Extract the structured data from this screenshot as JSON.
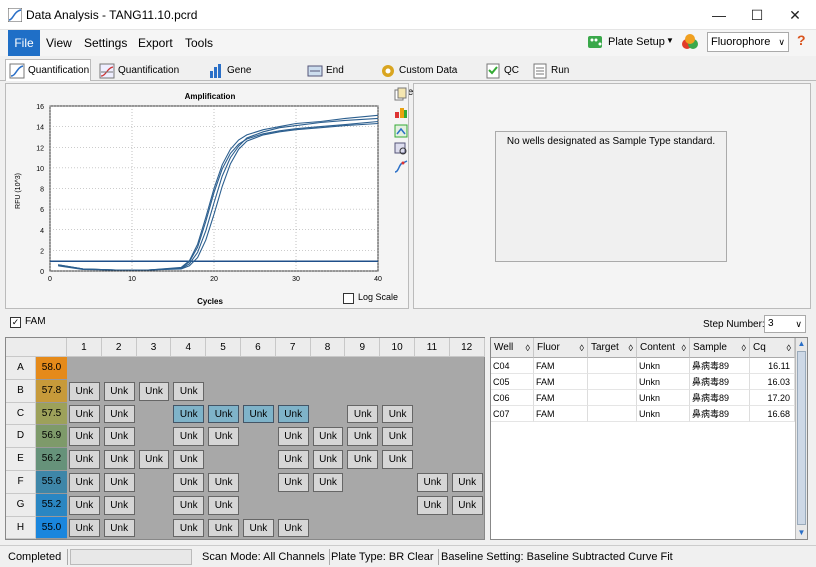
{
  "window": {
    "title": "Data Analysis - TANG11.10.pcrd",
    "minimize": "—",
    "maximize": "☐",
    "close": "✕"
  },
  "menu": [
    "File",
    "View",
    "Settings",
    "Export",
    "Tools"
  ],
  "toolbar": {
    "plate_setup": "Plate Setup",
    "fluorophore": "Fluorophore",
    "help": "?"
  },
  "tabs": [
    "Quantification",
    "Quantification Data",
    "Gene Expression",
    "End Point",
    "Custom Data View",
    "QC",
    "Run Information"
  ],
  "chart_panel": {
    "log_scale_label": "Log Scale"
  },
  "right_panel": {
    "message": "No wells designated as Sample Type standard."
  },
  "fam": {
    "label": "FAM",
    "step_label": "Step Number:",
    "step_value": "3"
  },
  "plate": {
    "cols": [
      "1",
      "2",
      "3",
      "4",
      "5",
      "6",
      "7",
      "8",
      "9",
      "10",
      "11",
      "12"
    ],
    "rows": [
      {
        "label": "A",
        "temp": "58.0",
        "color": "#e58a1a",
        "wells": [
          "",
          "",
          "",
          "",
          "",
          "",
          "",
          "",
          "",
          "",
          "",
          ""
        ]
      },
      {
        "label": "B",
        "temp": "57.8",
        "color": "#c79a3a",
        "wells": [
          "Unk",
          "Unk",
          "Unk",
          "Unk",
          "",
          "",
          "",
          "",
          "",
          "",
          "",
          ""
        ]
      },
      {
        "label": "C",
        "temp": "57.5",
        "color": "#9da15a",
        "wells": [
          "Unk",
          "Unk",
          "",
          "Unk",
          "Unk",
          "Unk",
          "Unk",
          "",
          "Unk",
          "Unk",
          "",
          ""
        ]
      },
      {
        "label": "D",
        "temp": "56.9",
        "color": "#7e9a6a",
        "wells": [
          "Unk",
          "Unk",
          "",
          "Unk",
          "Unk",
          "",
          "Unk",
          "Unk",
          "Unk",
          "Unk",
          "",
          ""
        ]
      },
      {
        "label": "E",
        "temp": "56.2",
        "color": "#66927a",
        "wells": [
          "Unk",
          "Unk",
          "Unk",
          "Unk",
          "",
          "",
          "Unk",
          "Unk",
          "Unk",
          "Unk",
          "",
          ""
        ]
      },
      {
        "label": "F",
        "temp": "55.6",
        "color": "#3e86a8",
        "wells": [
          "Unk",
          "Unk",
          "",
          "Unk",
          "Unk",
          "",
          "Unk",
          "Unk",
          "",
          "",
          "Unk",
          "Unk"
        ]
      },
      {
        "label": "G",
        "temp": "55.2",
        "color": "#2a86c2",
        "wells": [
          "Unk",
          "Unk",
          "",
          "Unk",
          "Unk",
          "",
          "",
          "",
          "",
          "",
          "Unk",
          "Unk"
        ]
      },
      {
        "label": "H",
        "temp": "55.0",
        "color": "#1a86dd",
        "wells": [
          "Unk",
          "Unk",
          "",
          "Unk",
          "Unk",
          "Unk",
          "Unk",
          "",
          "",
          "",
          "",
          ""
        ]
      }
    ]
  },
  "table": {
    "headers": [
      "Well",
      "Fluor",
      "Target",
      "Content",
      "Sample",
      "Cq"
    ],
    "rows": [
      [
        "C04",
        "FAM",
        "",
        "Unkn",
        "鼻病毒89",
        "16.11"
      ],
      [
        "C05",
        "FAM",
        "",
        "Unkn",
        "鼻病毒89",
        "16.03"
      ],
      [
        "C06",
        "FAM",
        "",
        "Unkn",
        "鼻病毒89",
        "17.20"
      ],
      [
        "C07",
        "FAM",
        "",
        "Unkn",
        "鼻病毒89",
        "16.68"
      ]
    ]
  },
  "status": {
    "state": "Completed",
    "scan_mode": "Scan Mode: All Channels",
    "plate_type": "Plate Type: BR Clear",
    "baseline": "Baseline Setting: Baseline Subtracted Curve Fit"
  },
  "chart_data": {
    "type": "line",
    "title": "Amplification",
    "xlabel": "Cycles",
    "ylabel": "RFU (10^3)",
    "xlim": [
      0,
      40
    ],
    "ylim": [
      0,
      16
    ],
    "xticks": [
      0,
      10,
      20,
      30,
      40
    ],
    "yticks": [
      0,
      2,
      4,
      6,
      8,
      10,
      12,
      14,
      16
    ],
    "threshold": 0.95,
    "grid": true,
    "series": [
      {
        "x": [
          1,
          4,
          8,
          12,
          16,
          17,
          18,
          19,
          20,
          21,
          22,
          23,
          24,
          26,
          28,
          30,
          33,
          36,
          40
        ],
        "values": [
          0.6,
          0.2,
          0.1,
          0.1,
          0.3,
          0.9,
          2.3,
          4.8,
          7.6,
          9.9,
          11.4,
          12.3,
          12.8,
          13.3,
          13.6,
          13.8,
          14.0,
          14.2,
          14.5
        ]
      },
      {
        "x": [
          1,
          4,
          8,
          12,
          16,
          17,
          18,
          19,
          20,
          21,
          22,
          23,
          24,
          26,
          28,
          30,
          33,
          36,
          40
        ],
        "values": [
          0.5,
          0.15,
          0.1,
          0.1,
          0.35,
          1.0,
          2.6,
          5.2,
          8.0,
          10.3,
          11.8,
          12.7,
          13.2,
          13.7,
          14.0,
          14.3,
          14.5,
          14.8,
          15.1
        ]
      },
      {
        "x": [
          1,
          4,
          8,
          12,
          16,
          17,
          18,
          19,
          20,
          21,
          22,
          23,
          24,
          26,
          28,
          30,
          33,
          36,
          40
        ],
        "values": [
          0.55,
          0.2,
          0.1,
          0.1,
          0.2,
          0.5,
          1.3,
          3.0,
          5.5,
          8.2,
          10.4,
          11.8,
          12.6,
          13.2,
          13.5,
          13.7,
          13.9,
          14.1,
          14.3
        ]
      },
      {
        "x": [
          1,
          4,
          8,
          12,
          16,
          17,
          18,
          19,
          20,
          21,
          22,
          23,
          24,
          26,
          28,
          30,
          33,
          36,
          40
        ],
        "values": [
          0.6,
          0.2,
          0.1,
          0.1,
          0.25,
          0.7,
          1.8,
          3.9,
          6.6,
          9.2,
          11.0,
          12.1,
          12.9,
          13.5,
          13.9,
          14.1,
          14.4,
          14.6,
          14.8
        ]
      }
    ]
  }
}
